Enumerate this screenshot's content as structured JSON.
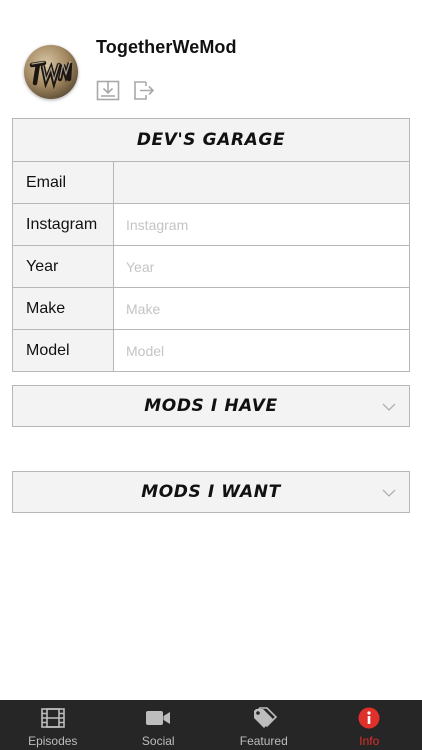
{
  "profile": {
    "username": "TogetherWeMod",
    "avatar_icon": "twm-logo-avatar",
    "download_icon": "download-icon",
    "logout_icon": "logout-icon"
  },
  "garage": {
    "title": "DEV'S GARAGE",
    "fields": [
      {
        "label": "Email",
        "value": "",
        "placeholder": ""
      },
      {
        "label": "Instagram",
        "value": "",
        "placeholder": "Instagram"
      },
      {
        "label": "Year",
        "value": "",
        "placeholder": "Year"
      },
      {
        "label": "Make",
        "value": "",
        "placeholder": "Make"
      },
      {
        "label": "Model",
        "value": "",
        "placeholder": "Model"
      }
    ]
  },
  "sections": {
    "mods_have": "MODS I HAVE",
    "mods_want": "MODS I WANT"
  },
  "tabs": [
    {
      "label": "Episodes",
      "icon": "film-icon",
      "active": false
    },
    {
      "label": "Social",
      "icon": "video-camera-icon",
      "active": false
    },
    {
      "label": "Featured",
      "icon": "tags-icon",
      "active": false
    },
    {
      "label": "Info",
      "icon": "info-icon",
      "active": true
    }
  ],
  "colors": {
    "accent": "#e0302b",
    "tabbar": "#262626",
    "card_bg": "#f3f3f3",
    "border": "#b7b7b7"
  }
}
